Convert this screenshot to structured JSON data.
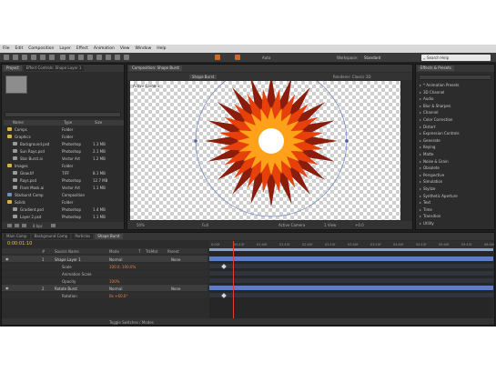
{
  "menu": [
    "File",
    "Edit",
    "Composition",
    "Layer",
    "Effect",
    "Animation",
    "View",
    "Window",
    "Help"
  ],
  "toolbar": {
    "labels": [
      "Auto",
      "Workspace:",
      "Standard"
    ],
    "search_placeholder": "Search Help"
  },
  "project": {
    "tabs": [
      "Project",
      "Effect Controls: Shape Layer 1"
    ],
    "columns": [
      "Name",
      "Type",
      "Size"
    ],
    "items": [
      {
        "name": "Comps",
        "type": "Folder",
        "size": ""
      },
      {
        "name": "Graphics",
        "type": "Folder",
        "size": ""
      },
      {
        "name": "Background.psd",
        "type": "Photoshop",
        "size": "1.3 MB"
      },
      {
        "name": "Sun Rays.psd",
        "type": "Photoshop",
        "size": "2.1 MB"
      },
      {
        "name": "Star Burst.ai",
        "type": "Vector Art",
        "size": "1.2 MB"
      },
      {
        "name": "Images",
        "type": "Folder",
        "size": ""
      },
      {
        "name": "Glow.tif",
        "type": "TIFF",
        "size": "8.1 MB"
      },
      {
        "name": "Rays.psd",
        "type": "Photoshop",
        "size": "12.7 MB"
      },
      {
        "name": "Flare Mask.ai",
        "type": "Vector Art",
        "size": "1.1 MB"
      },
      {
        "name": "Starburst Comp",
        "type": "Composition",
        "size": ""
      },
      {
        "name": "Solids",
        "type": "Folder",
        "size": ""
      },
      {
        "name": "Gradient.psd",
        "type": "Photoshop",
        "size": "1.4 MB"
      },
      {
        "name": "Layer 2.psd",
        "type": "Photoshop",
        "size": "1.1 MB"
      }
    ],
    "footer_label": "8 bpc"
  },
  "comp_viewer": {
    "tabs": [
      "Composition: Shape Burst"
    ],
    "subtab": "Shape Burst",
    "overlay_label": "Active Camera",
    "renderer": "Renderer: Classic 3D",
    "bottom_items": [
      "50%",
      "Full",
      "Active Camera",
      "1 View",
      "+0.0"
    ],
    "colors": {
      "outer": "#8b1d0c",
      "mid": "#e8400a",
      "inner": "#ffa21a",
      "core": "#f6c24a"
    }
  },
  "effects": {
    "tab": "Effects & Presets",
    "search": "",
    "items": [
      "* Animation Presets",
      "3D Channel",
      "Audio",
      "Blur & Sharpen",
      "Channel",
      "Color Correction",
      "Distort",
      "Expression Controls",
      "Generate",
      "Keying",
      "Matte",
      "Noise & Grain",
      "Obsolete",
      "Perspective",
      "Simulation",
      "Stylize",
      "Synthetic Aperture",
      "Text",
      "Time",
      "Transition",
      "Utility"
    ]
  },
  "timeline": {
    "tabs": [
      "Main Comp",
      "Background Comp",
      "Particles",
      "Shape Burst"
    ],
    "timecode": "0:00:01:10",
    "header": [
      "#",
      "Source Name",
      "Mode",
      "T",
      "TrkMat",
      "Parent"
    ],
    "layers": [
      {
        "num": "1",
        "name": "Shape Layer 1",
        "mode": "Normal",
        "parent": "None"
      },
      {
        "num": "",
        "name": "Scale",
        "mode": "100.0, 100.0%",
        "parent": ""
      },
      {
        "num": "",
        "name": "Animation Scale",
        "mode": "",
        "parent": ""
      },
      {
        "num": "",
        "name": "Opacity",
        "mode": "100%",
        "parent": ""
      },
      {
        "num": "2",
        "name": "Rotate Burst",
        "mode": "Normal",
        "parent": "None"
      },
      {
        "num": "",
        "name": "Rotation",
        "mode": "0x +60.0°",
        "parent": ""
      }
    ],
    "ruler": [
      "0:00f",
      "00:15f",
      "01:00f",
      "01:15f",
      "02:00f",
      "02:15f",
      "03:00f",
      "03:15f",
      "04:00f",
      "04:15f",
      "05:00f",
      "05:15f",
      "06:00f"
    ],
    "footer": "Toggle Switches / Modes",
    "layer_color": "#5d7fbf",
    "playhead_color": "#e0412e",
    "workarea_color": "#8aa0c0"
  }
}
